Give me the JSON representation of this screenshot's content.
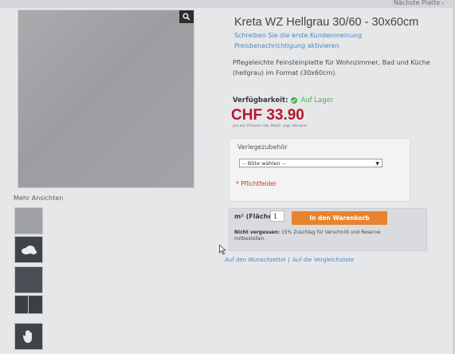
{
  "nav": {
    "next_product": "Nächste Platte"
  },
  "product": {
    "title": "Kreta WZ Hellgrau 30/60 - 30x60cm",
    "review_link": "Schreiben Sie die erste Kundenmeinung",
    "price_alert_link": "Preisbenachrichtigung aktivieren",
    "description": "Pflegeleichte Feinsteinplatte für Wohnzimmer, Bad und Küche (hellgrau) im Format (30x60cm).",
    "availability_label": "Verfügbarkeit:",
    "availability_value": "Auf Lager",
    "price": "CHF 33.90",
    "price_note": "pro m2 (Fläche) inkl. MwSt. zzgl. Versand"
  },
  "gallery": {
    "more_views_label": "Mehr Ansichten"
  },
  "options": {
    "label": "Verlegezubehör",
    "select_value": "-- Bitte wählen --",
    "required_text": "* Pflichtfelder"
  },
  "cart": {
    "qty_label": "m² (Fläche)",
    "qty_value": "1",
    "button_label": "In den Warenkorb",
    "note_bold": "Nicht vergessen:",
    "note_text": "15% Zuschlag für Verschnitt und Reserve mitbestellen."
  },
  "links": {
    "wishlist": "Auf den Wunschzettel",
    "separator": "|",
    "compare": "Auf die Vergleichsliste"
  },
  "colors": {
    "price": "#b5162c",
    "link": "#4a86c8",
    "cart_button": "#e8832d",
    "in_stock": "#3fae49"
  }
}
